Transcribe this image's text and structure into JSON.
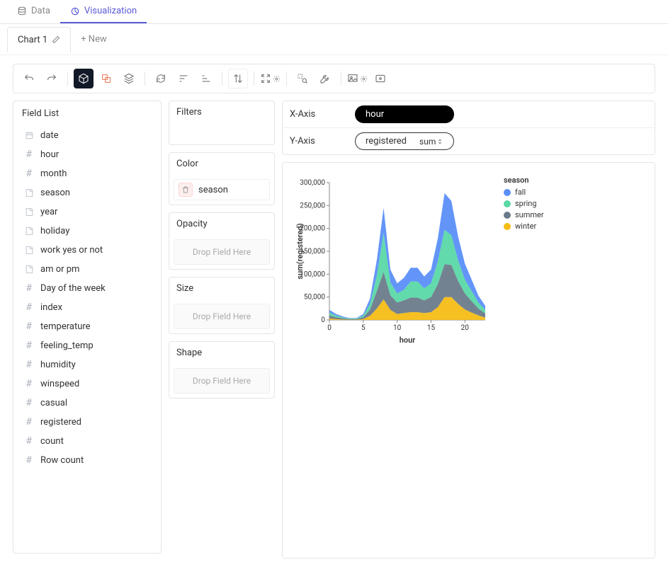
{
  "tabs": {
    "data": "Data",
    "visualization": "Visualization"
  },
  "chart_tabs": {
    "chart1": "Chart 1",
    "new": "+ New"
  },
  "field_list": {
    "title": "Field List",
    "items": [
      {
        "name": "date",
        "type": "date"
      },
      {
        "name": "hour",
        "type": "number"
      },
      {
        "name": "month",
        "type": "number"
      },
      {
        "name": "season",
        "type": "text"
      },
      {
        "name": "year",
        "type": "text"
      },
      {
        "name": "holiday",
        "type": "text"
      },
      {
        "name": "work yes or not",
        "type": "text"
      },
      {
        "name": "am or pm",
        "type": "text"
      },
      {
        "name": "Day of the week",
        "type": "number"
      },
      {
        "name": "index",
        "type": "number"
      },
      {
        "name": "temperature",
        "type": "number"
      },
      {
        "name": "feeling_temp",
        "type": "number"
      },
      {
        "name": "humidity",
        "type": "number"
      },
      {
        "name": "winspeed",
        "type": "number"
      },
      {
        "name": "casual",
        "type": "number"
      },
      {
        "name": "registered",
        "type": "number"
      },
      {
        "name": "count",
        "type": "number"
      },
      {
        "name": "Row count",
        "type": "number"
      }
    ]
  },
  "encodings": {
    "filters": {
      "title": "Filters"
    },
    "color": {
      "title": "Color",
      "field": "season"
    },
    "opacity": {
      "title": "Opacity",
      "placeholder": "Drop Field Here"
    },
    "size": {
      "title": "Size",
      "placeholder": "Drop Field Here"
    },
    "shape": {
      "title": "Shape",
      "placeholder": "Drop Field Here"
    }
  },
  "axes": {
    "x": {
      "label": "X-Axis",
      "field": "hour"
    },
    "y": {
      "label": "Y-Axis",
      "field": "registered",
      "agg": "sum"
    }
  },
  "legend": {
    "title": "season",
    "items": [
      {
        "label": "fall",
        "color": "#5b8ff9"
      },
      {
        "label": "spring",
        "color": "#5ad8a6"
      },
      {
        "label": "summer",
        "color": "#6c7b8b"
      },
      {
        "label": "winter",
        "color": "#f6bd16"
      }
    ]
  },
  "chart_data": {
    "type": "area",
    "title": "",
    "xlabel": "hour",
    "ylabel": "sum(registered)",
    "xlim": [
      0,
      23
    ],
    "ylim": [
      0,
      300000
    ],
    "x_ticks": [
      0,
      5,
      10,
      15,
      20
    ],
    "y_ticks": [
      0,
      50000,
      100000,
      150000,
      200000,
      250000,
      300000
    ],
    "x": [
      0,
      1,
      2,
      3,
      4,
      5,
      6,
      7,
      8,
      9,
      10,
      11,
      12,
      13,
      14,
      15,
      16,
      17,
      18,
      19,
      20,
      21,
      22,
      23
    ],
    "series": [
      {
        "name": "winter",
        "color": "#f6bd16",
        "values": [
          3000,
          2000,
          1000,
          500,
          500,
          2000,
          9000,
          25000,
          45000,
          22000,
          13000,
          15000,
          17000,
          17000,
          15000,
          17000,
          28000,
          50000,
          50000,
          35000,
          23000,
          16000,
          10000,
          5000
        ]
      },
      {
        "name": "summer",
        "color": "#6c7b8b",
        "values": [
          7000,
          4000,
          2500,
          1500,
          1500,
          4000,
          14000,
          38000,
          60000,
          32000,
          25000,
          28000,
          32000,
          32000,
          28000,
          33000,
          50000,
          72000,
          70000,
          50000,
          35000,
          25000,
          15000,
          9000
        ]
      },
      {
        "name": "spring",
        "color": "#5ad8a6",
        "values": [
          6000,
          3500,
          2000,
          1000,
          1000,
          3500,
          12000,
          34000,
          85000,
          28000,
          20000,
          23000,
          35000,
          35000,
          26000,
          30000,
          50000,
          75000,
          65000,
          45000,
          30000,
          22000,
          13000,
          8000
        ]
      },
      {
        "name": "fall",
        "color": "#5b8ff9",
        "values": [
          6000,
          3500,
          2000,
          1000,
          1000,
          3500,
          12000,
          34000,
          55000,
          28000,
          22000,
          26000,
          30000,
          30000,
          26000,
          30000,
          50000,
          80000,
          75000,
          52000,
          35000,
          25000,
          15000,
          9000
        ]
      }
    ]
  }
}
